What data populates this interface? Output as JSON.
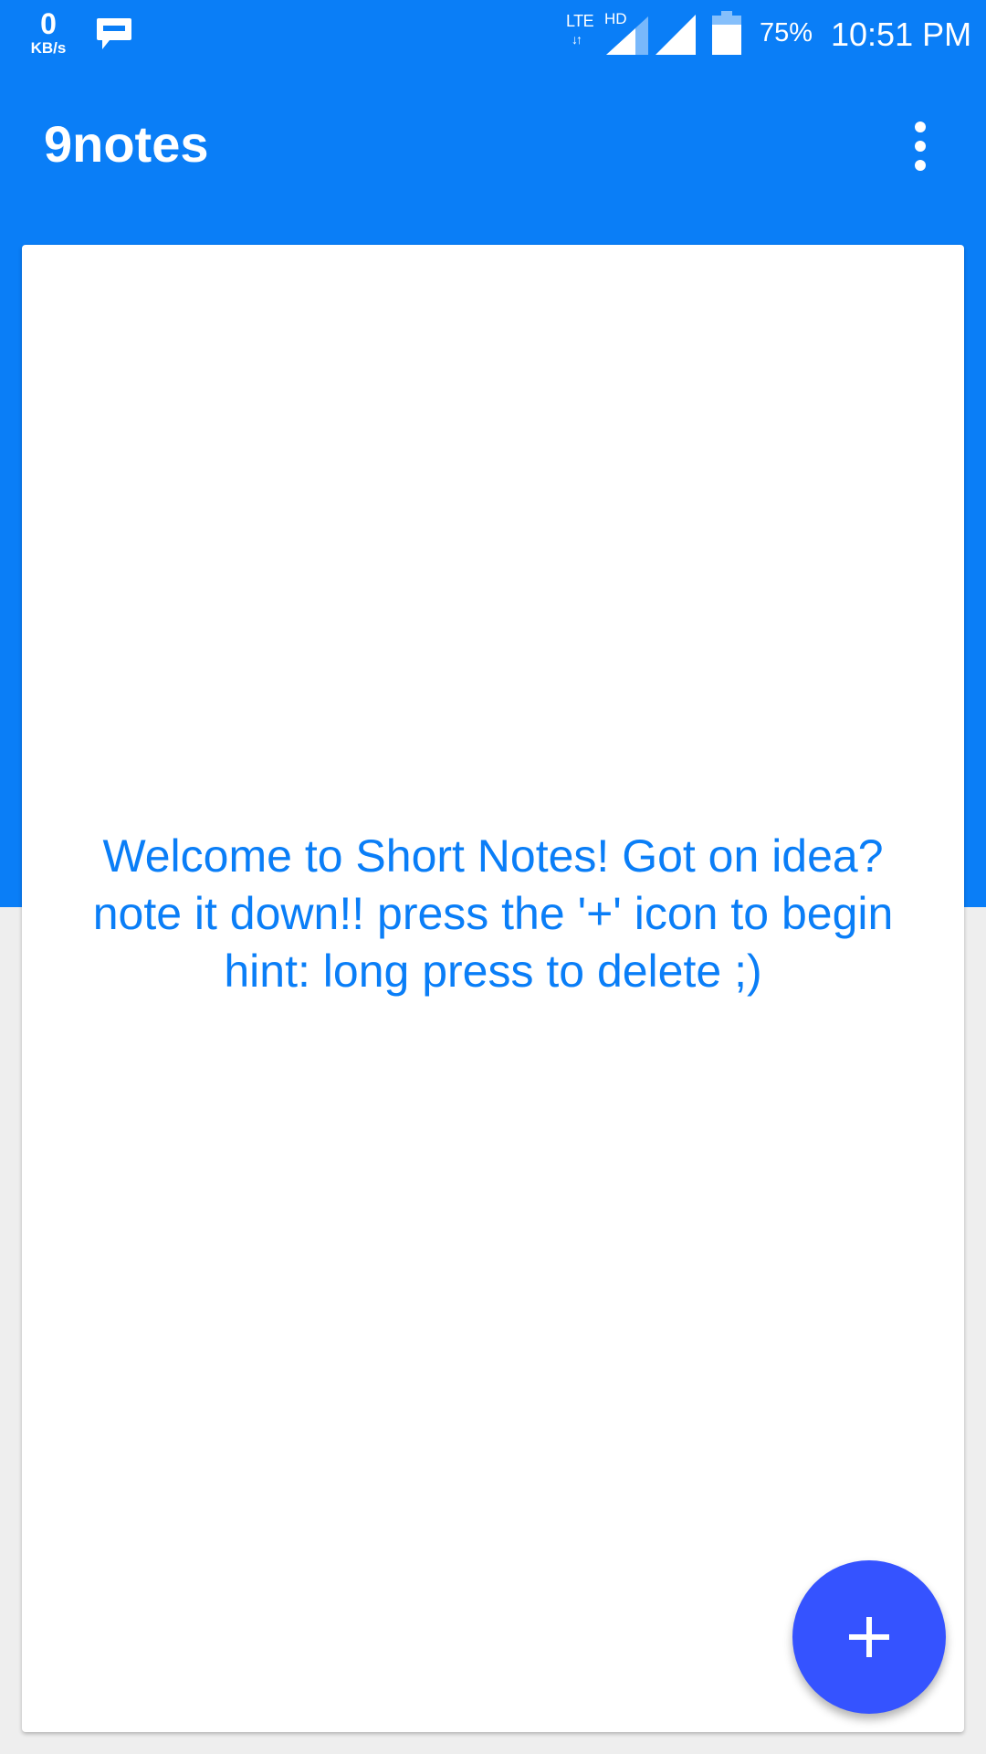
{
  "status_bar": {
    "net_speed_value": "0",
    "net_speed_unit": "KB/s",
    "network_type": "LTE",
    "network_arrows": "↓↑",
    "hd_label": "HD",
    "battery_percent": "75%",
    "time": "10:51 PM",
    "icons": [
      "message-icon",
      "signal-icon",
      "signal-icon",
      "battery-icon"
    ]
  },
  "app_bar": {
    "title": "9notes",
    "overflow_icon": "more-vert-icon"
  },
  "main": {
    "welcome_lines": [
      "Welcome to Short Notes! Got on idea?",
      "note it down!! press the '+' icon to begin",
      "hint: long press to delete ;)"
    ]
  },
  "fab": {
    "icon": "plus-icon"
  },
  "colors": {
    "primary": "#0A7EF7",
    "fab": "#3553FF",
    "background": "#eeeeee",
    "card": "#ffffff",
    "text_accent": "#0A7EF7"
  }
}
